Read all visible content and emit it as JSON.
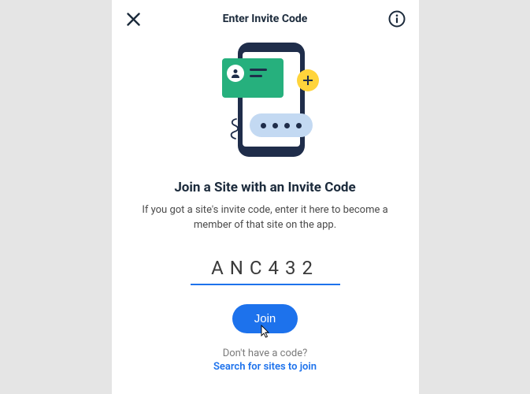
{
  "header": {
    "title": "Enter Invite Code"
  },
  "main": {
    "heading": "Join a Site with an Invite Code",
    "subtext": "If you got a site's invite code, enter it here to become a member of that site on the app.",
    "code_value": "ANC432",
    "join_label": "Join"
  },
  "footer": {
    "question": "Don't have a code?",
    "search_link": "Search for sites to join"
  },
  "colors": {
    "accent": "#1d72ec",
    "plus_bg": "#ffd43b",
    "card_bg": "#26b07d",
    "bubble_bg": "#c3d9f2",
    "phone_bg": "#1f2d4a"
  }
}
